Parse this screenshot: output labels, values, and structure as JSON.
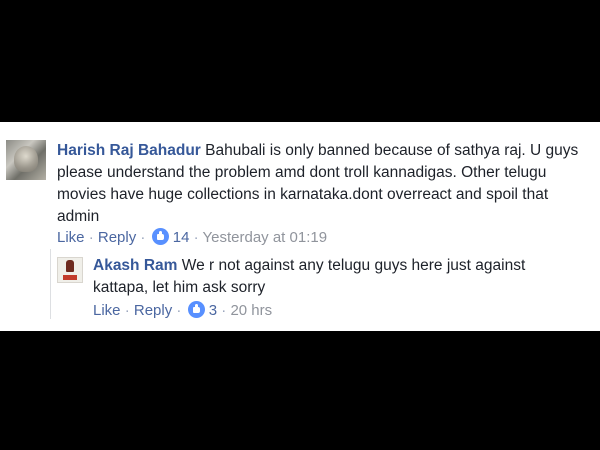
{
  "comments": [
    {
      "author": "Harish Raj Bahadur",
      "text": "Bahubali is only banned because of sathya raj. U guys please understand the problem amd dont troll kannadigas. Other telugu movies have huge collections in karnataka.dont overreact and spoil that admin",
      "like_label": "Like",
      "reply_label": "Reply",
      "reactions": "14",
      "timestamp": "Yesterday at 01:19",
      "avatar_icon": "profile-photo-icon"
    },
    {
      "author": "Akash Ram",
      "text": "We r not against any telugu guys here just against kattapa, let him ask sorry",
      "like_label": "Like",
      "reply_label": "Reply",
      "reactions": "3",
      "timestamp": "20 hrs",
      "avatar_icon": "profile-photo-icon"
    }
  ],
  "separator": "·",
  "colors": {
    "author": "#365899",
    "link": "#4b67a1",
    "text": "#1d2129",
    "reaction_badge": "#5890ff",
    "background": "#000000",
    "panel": "#ffffff"
  }
}
